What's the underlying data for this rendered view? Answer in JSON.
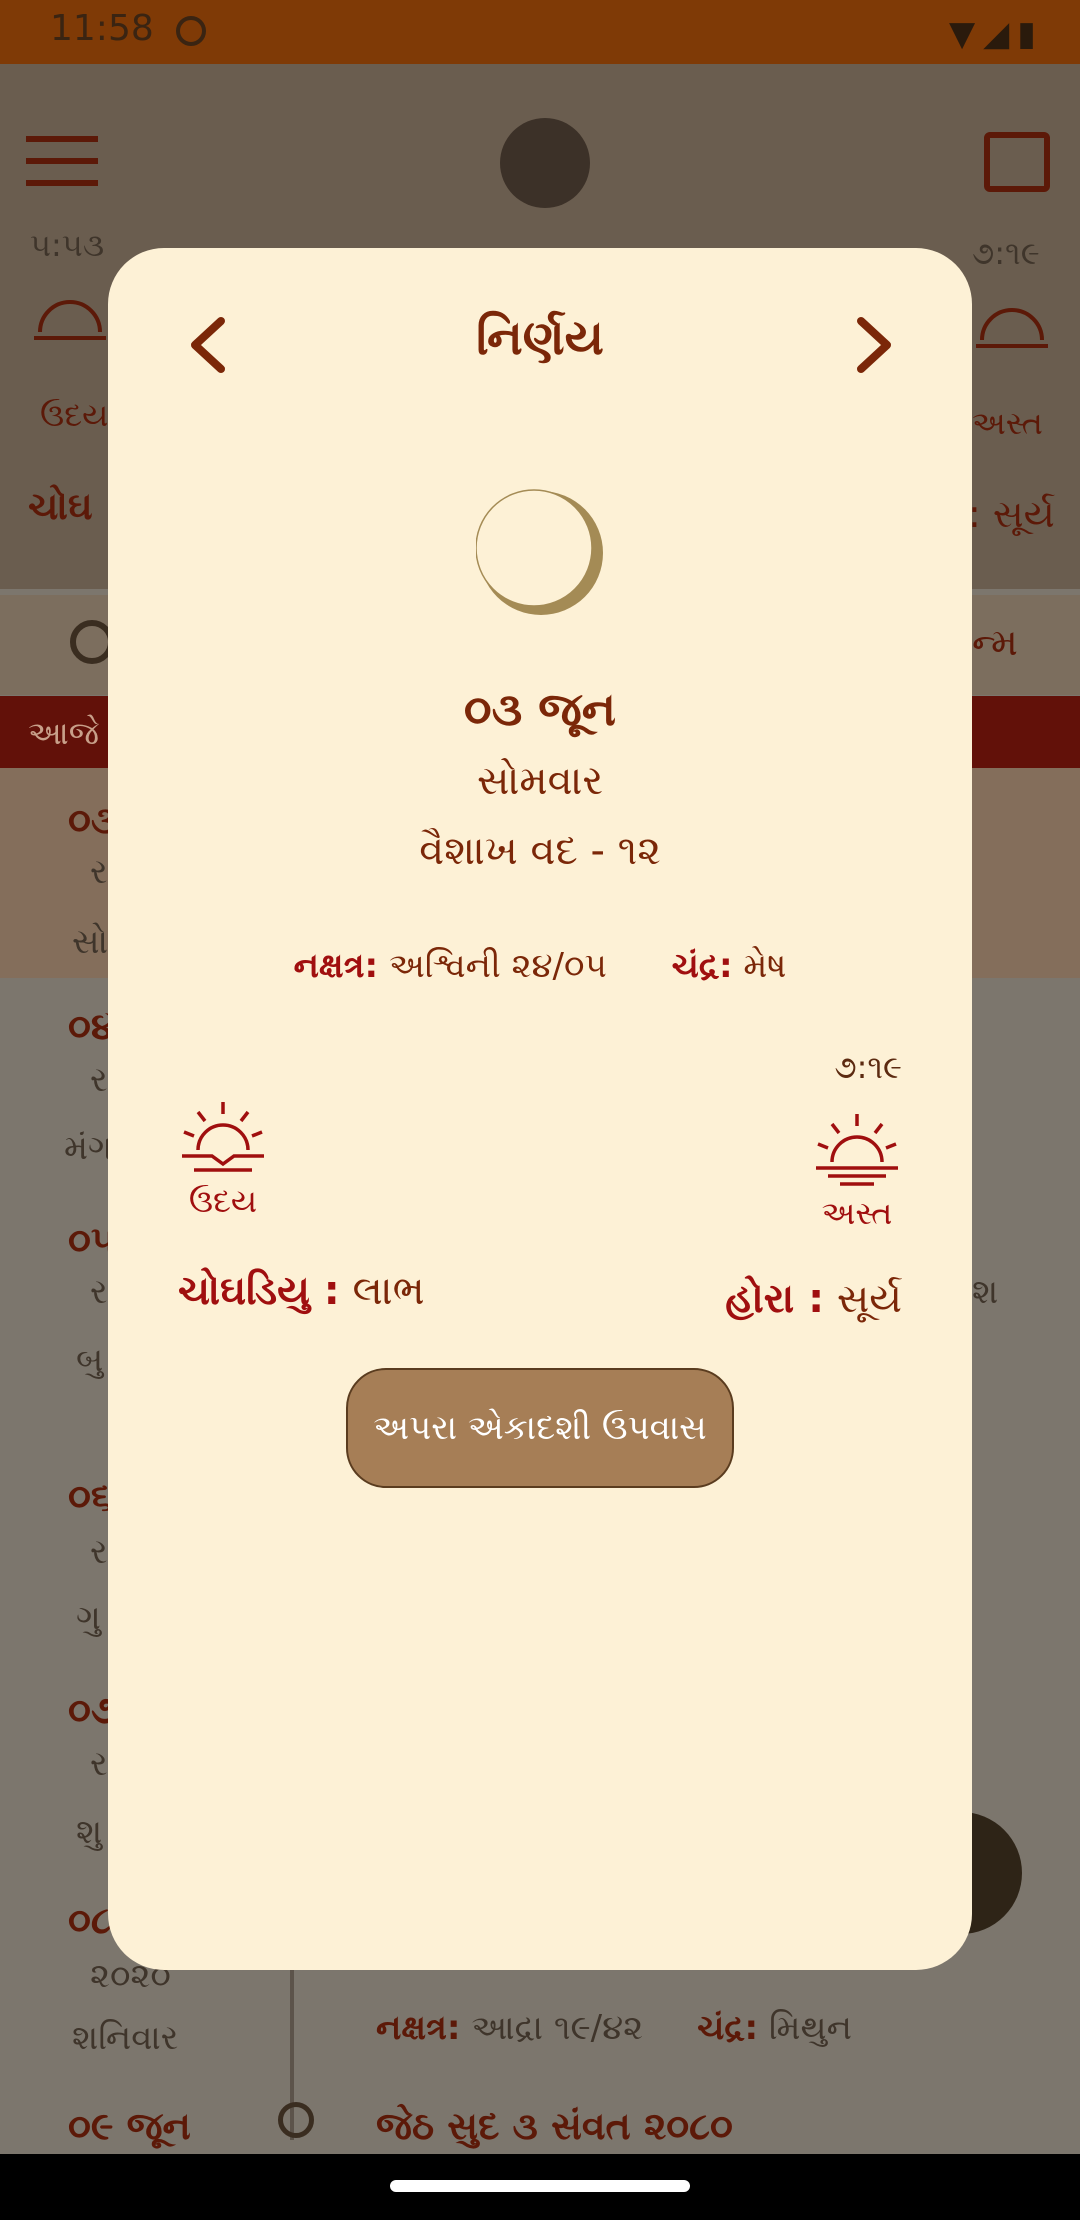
{
  "status_bar": {
    "time": "11:58"
  },
  "background": {
    "sunrise_time": "૫:૫૩",
    "sunset_time": "૭:૧૯",
    "sunrise_label": "ઉદય",
    "sunset_label": "અસ્ત",
    "choghadiya_label": "ચોઘ",
    "hora_fragment": ": સૂર્ય",
    "janam": "ન્મ",
    "aaje": "આજે",
    "rows": [
      {
        "d": "૦૩",
        "s": "ર",
        "w": "સો"
      },
      {
        "d": "૦૪",
        "s": "ર",
        "w": "મંગ"
      },
      {
        "d": "૦૫",
        "s": "ર",
        "w": "બુ"
      },
      {
        "d": "૦૬",
        "s": "ર",
        "w": "ગુ"
      },
      {
        "d": "૦૭",
        "s": "ર",
        "w": "શુ"
      },
      {
        "d": "૦૮",
        "s": "૨૦૨૦",
        "w": "શનિવાર"
      }
    ],
    "row_frag": "શ",
    "nakshatra_row": {
      "label": "નક્ષત્ર:",
      "value": "આદ્રા ૧૯/૪૨",
      "chandra_label": "ચંદ્ર:",
      "chandra_value": "મિથુન"
    },
    "last_date": "૦૯ જૂન",
    "last_title": "જેઠ સુદ ૩ સંવત ૨૦૮૦"
  },
  "dialog": {
    "title": "નિર્ણય",
    "date": "૦૩ જૂન",
    "weekday": "સોમવાર",
    "tithi": "વૈશાખ વદ - ૧૨",
    "nakshatra_label": "નક્ષત્ર:",
    "nakshatra_value": "અશ્વિની ૨૪/૦૫",
    "chandra_label": "ચંદ્ર:",
    "chandra_value": "મેષ",
    "sunset_time": "૭:૧૯",
    "sunrise_label": "ઉદય",
    "sunset_label": "અસ્ત",
    "choghadiya_label": "ચોઘડિયુ :",
    "choghadiya_value": "લાભ",
    "hora_label": "હોરા :",
    "hora_value": "સૂર્ય",
    "festival": "અપરા એકાદશી ઉપવાસ"
  },
  "icons": {
    "prev": "chevron-left-icon",
    "next": "chevron-right-icon",
    "moon": "moon-phase-icon",
    "sunrise": "sunrise-icon",
    "sunset": "sunset-icon"
  }
}
